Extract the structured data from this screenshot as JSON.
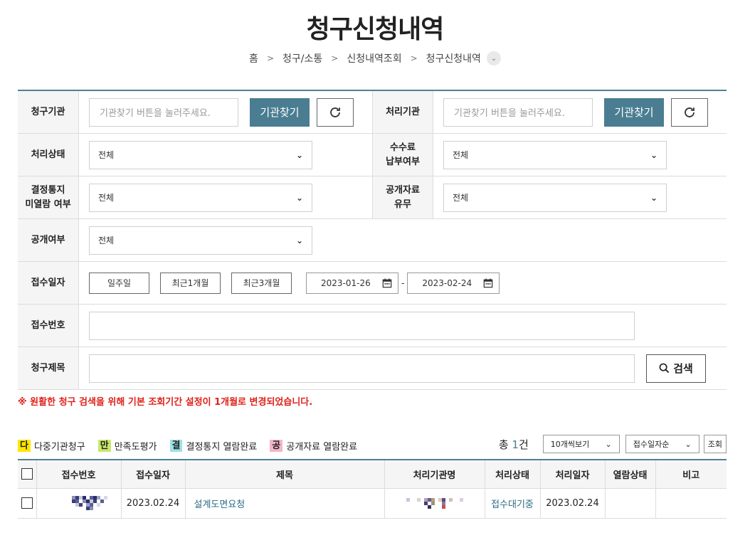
{
  "page": {
    "title": "청구신청내역",
    "breadcrumb": [
      "홈",
      "청구/소통",
      "신청내역조회",
      "청구신청내역"
    ]
  },
  "form": {
    "request_org": {
      "label": "청구기관",
      "placeholder": "기관찾기 버튼을 눌러주세요.",
      "find_label": "기관찾기"
    },
    "process_org": {
      "label": "처리기관",
      "placeholder": "기관찾기 버튼을 눌러주세요.",
      "find_label": "기관찾기"
    },
    "status": {
      "label": "처리상태",
      "value": "전체"
    },
    "fee": {
      "label_line1": "수수료",
      "label_line2": "납부여부",
      "value": "전체"
    },
    "decision": {
      "label_line1": "결정통지",
      "label_line2": "미열람 여부",
      "value": "전체"
    },
    "public_data": {
      "label_line1": "공개자료",
      "label_line2": "유무",
      "value": "전체"
    },
    "disclosure": {
      "label": "공개여부",
      "value": "전체"
    },
    "receipt_date": {
      "label": "접수일자",
      "periods": [
        "일주일",
        "최근1개월",
        "최근3개월"
      ],
      "start": "2023-01-26",
      "end": "2023-02-24",
      "separator": "-"
    },
    "receipt_no": {
      "label": "접수번호",
      "value": ""
    },
    "request_title": {
      "label": "청구제목",
      "value": ""
    },
    "search_label": "검색"
  },
  "notice": "※ 원활한 청구 검색을 위해 기본 조회기간 설정이 1개월로 변경되었습니다.",
  "legend": [
    {
      "mark": "다",
      "text": "다중기관청구",
      "color": "#ffe600"
    },
    {
      "mark": "만",
      "text": "만족도평가",
      "color": "#c9e86c"
    },
    {
      "mark": "결",
      "text": "결정통지 열람완료",
      "color": "#9fe0e6"
    },
    {
      "mark": "공",
      "text": "공개자료 열람완료",
      "color": "#f4b6c8"
    }
  ],
  "list": {
    "total_prefix": "총 ",
    "total_count": "1",
    "total_suffix": "건",
    "page_size": "10개씩보기",
    "sort": "접수일자순",
    "view_label": "조회",
    "headers": [
      "접수번호",
      "접수일자",
      "제목",
      "처리기관명",
      "처리상태",
      "처리일자",
      "열람상태",
      "비고"
    ],
    "rows": [
      {
        "receipt_date": "2023.02.24",
        "title": "설계도면요청",
        "status": "접수대기중",
        "process_date": "2023.02.24",
        "read_status": "",
        "note": ""
      }
    ]
  }
}
